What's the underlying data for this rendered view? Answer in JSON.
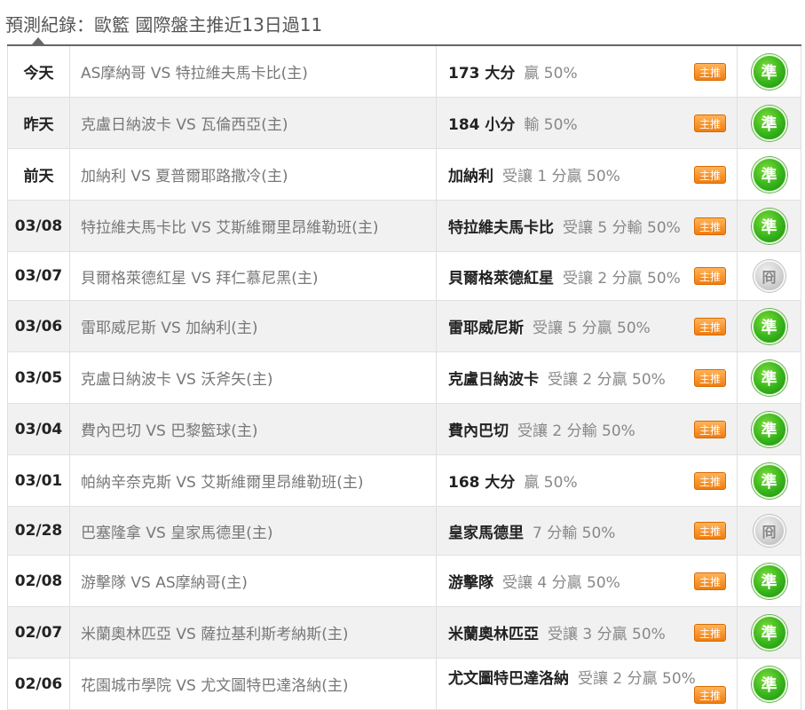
{
  "page": {
    "title": "預測紀錄：歐籃 國際盤主推近13日過11"
  },
  "colors": {
    "win_badge": "#36b41b",
    "push_badge": "#cfcfcf",
    "tag_badge": "#f07d10",
    "header_rule": "#666666"
  },
  "rows": [
    {
      "date": "今天",
      "match": "AS摩納哥 VS 特拉維夫馬卡比(主)",
      "pick": "173 大分",
      "detail": "贏 50%",
      "tag": "主推",
      "result": "準",
      "result_type": "win"
    },
    {
      "date": "昨天",
      "match": "克盧日納波卡 VS 瓦倫西亞(主)",
      "pick": "184 小分",
      "detail": "輸 50%",
      "tag": "主推",
      "result": "準",
      "result_type": "win"
    },
    {
      "date": "前天",
      "match": "加納利 VS 夏普爾耶路撒冷(主)",
      "pick": "加納利",
      "detail": "受讓 1 分贏 50%",
      "tag": "主推",
      "result": "準",
      "result_type": "win"
    },
    {
      "date": "03/08",
      "match": "特拉維夫馬卡比 VS 艾斯維爾里昂維勒班(主)",
      "pick": "特拉維夫馬卡比",
      "detail": "受讓 5 分輸 50%",
      "tag": "主推",
      "result": "準",
      "result_type": "win"
    },
    {
      "date": "03/07",
      "match": "貝爾格萊德紅星 VS 拜仁慕尼黑(主)",
      "pick": "貝爾格萊德紅星",
      "detail": "受讓 2 分贏 50%",
      "tag": "主推",
      "result": "冏",
      "result_type": "push"
    },
    {
      "date": "03/06",
      "match": "雷耶威尼斯 VS 加納利(主)",
      "pick": "雷耶威尼斯",
      "detail": "受讓 5 分贏 50%",
      "tag": "主推",
      "result": "準",
      "result_type": "win"
    },
    {
      "date": "03/05",
      "match": "克盧日納波卡 VS 沃斧矢(主)",
      "pick": "克盧日納波卡",
      "detail": "受讓 2 分贏 50%",
      "tag": "主推",
      "result": "準",
      "result_type": "win"
    },
    {
      "date": "03/04",
      "match": "費內巴切 VS 巴黎籃球(主)",
      "pick": "費內巴切",
      "detail": "受讓 2 分輸 50%",
      "tag": "主推",
      "result": "準",
      "result_type": "win"
    },
    {
      "date": "03/01",
      "match": "帕納辛奈克斯 VS 艾斯維爾里昂維勒班(主)",
      "pick": "168 大分",
      "detail": "贏 50%",
      "tag": "主推",
      "result": "準",
      "result_type": "win"
    },
    {
      "date": "02/28",
      "match": "巴塞隆拿 VS 皇家馬德里(主)",
      "pick": "皇家馬德里",
      "detail": "7 分輸 50%",
      "tag": "主推",
      "result": "冏",
      "result_type": "push"
    },
    {
      "date": "02/08",
      "match": "游擊隊 VS AS摩納哥(主)",
      "pick": "游擊隊",
      "detail": "受讓 4 分贏 50%",
      "tag": "主推",
      "result": "準",
      "result_type": "win"
    },
    {
      "date": "02/07",
      "match": "米蘭奧林匹亞 VS 薩拉基利斯考納斯(主)",
      "pick": "米蘭奧林匹亞",
      "detail": "受讓 3 分贏 50%",
      "tag": "主推",
      "result": "準",
      "result_type": "win"
    },
    {
      "date": "02/06",
      "match": "花園城市學院 VS 尤文圖特巴達洛納(主)",
      "pick": "尤文圖特巴達洛納",
      "detail": "受讓 2 分贏 50%",
      "tag": "主推",
      "result": "準",
      "result_type": "win"
    }
  ]
}
